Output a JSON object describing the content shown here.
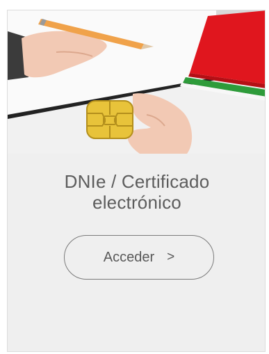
{
  "card": {
    "title_line1": "DNIe / Certificado",
    "title_line2": "electrónico",
    "button_label": "Acceder",
    "button_chevron": ">"
  },
  "hero": {
    "icon": "smart-card-photo",
    "colors": {
      "folder_red": "#e0161e",
      "folder_green": "#2e9b3a",
      "chip_gold": "#e8c33a",
      "pencil_yellow": "#f0a24a"
    }
  }
}
